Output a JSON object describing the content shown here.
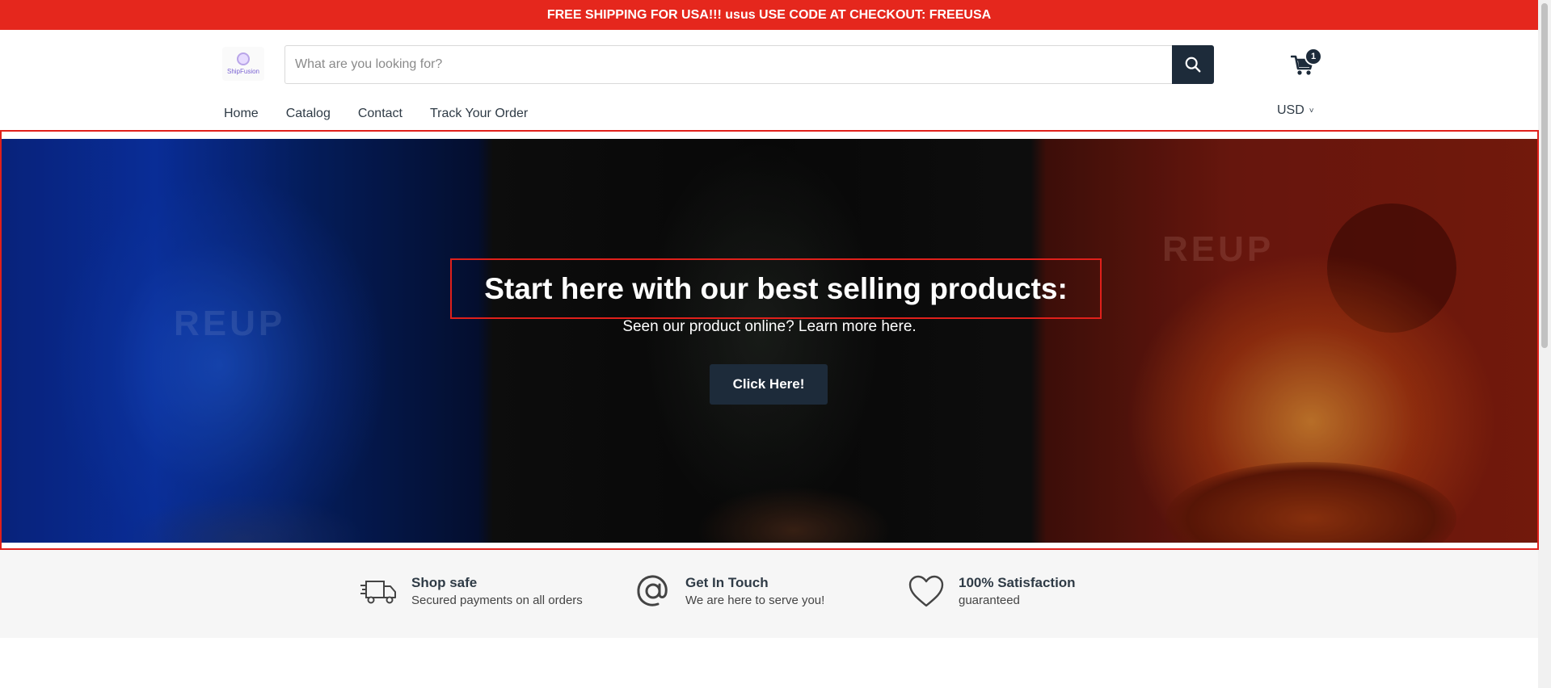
{
  "announcement": "FREE SHIPPING FOR USA!!! usus USE CODE AT CHECKOUT: FREEUSA",
  "logo": {
    "text": "ShipFusion"
  },
  "search": {
    "placeholder": "What are you looking for?"
  },
  "cart": {
    "count": "1"
  },
  "nav": {
    "items": [
      "Home",
      "Catalog",
      "Contact",
      "Track Your Order"
    ]
  },
  "currency": "USD",
  "hero": {
    "watermark_left": "REUP",
    "watermark_right": "REUP",
    "headline": "Start here with our best selling products:",
    "subheading": "Seen our product online? Learn more here.",
    "cta_label": "Click Here!"
  },
  "features": [
    {
      "title": "Shop safe",
      "desc": "Secured payments on all orders",
      "icon": "truck-icon"
    },
    {
      "title": "Get In Touch",
      "desc": "We are here to serve you!",
      "icon": "at-sign-icon"
    },
    {
      "title": "100% Satisfaction",
      "desc": "guaranteed",
      "icon": "heart-icon"
    }
  ],
  "colors": {
    "announcement_bg": "#e5271d",
    "primary_dark": "#1d2b3a",
    "highlight_border": "#e0201b",
    "features_bg": "#f6f6f6"
  }
}
